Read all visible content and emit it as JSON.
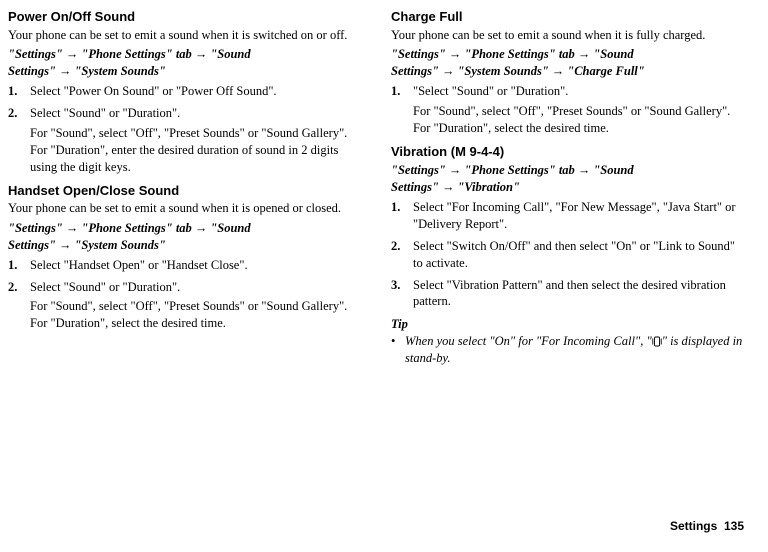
{
  "left": {
    "s1": {
      "title": "Power On/Off Sound",
      "intro": "Your phone can be set to emit a sound when it is switched on or off.",
      "path": [
        "\"Settings\"",
        "\"Phone Settings\" tab",
        "\"Sound Settings\"",
        "\"System Sounds\""
      ],
      "steps": [
        {
          "main": "Select \"Power On Sound\" or \"Power Off Sound\"."
        },
        {
          "main": "Select \"Sound\" or \"Duration\".",
          "sub": "For \"Sound\", select \"Off\", \"Preset Sounds\" or \"Sound Gallery\".\nFor \"Duration\", enter the desired duration of sound in 2 digits using the digit keys."
        }
      ]
    },
    "s2": {
      "title": "Handset Open/Close Sound",
      "intro": "Your phone can be set to emit a sound when it is opened or closed.",
      "path": [
        "\"Settings\"",
        "\"Phone Settings\" tab",
        "\"Sound Settings\"",
        "\"System Sounds\""
      ],
      "steps": [
        {
          "main": "Select \"Handset Open\" or \"Handset Close\"."
        },
        {
          "main": "Select \"Sound\" or \"Duration\".",
          "sub": "For \"Sound\", select \"Off\", \"Preset Sounds\" or \"Sound Gallery\".\nFor \"Duration\", select the desired time."
        }
      ]
    }
  },
  "right": {
    "s1": {
      "title": "Charge Full",
      "intro": "Your phone can be set to emit a sound when it is fully charged.",
      "path": [
        "\"Settings\"",
        "\"Phone Settings\" tab",
        "\"Sound Settings\"",
        "\"System Sounds\"",
        "\"Charge Full\""
      ],
      "steps": [
        {
          "main": "\"Select \"Sound\" or \"Duration\".",
          "sub": "For \"Sound\", select \"Off\", \"Preset Sounds\" or \"Sound Gallery\".\nFor \"Duration\", select the desired time."
        }
      ]
    },
    "s2": {
      "title": "Vibration",
      "mcode": "(M 9-4-4)",
      "path": [
        "\"Settings\"",
        "\"Phone Settings\" tab",
        "\"Sound Settings\"",
        "\"Vibration\""
      ],
      "steps": [
        {
          "main": "Select \"For Incoming Call\", \"For New Message\", \"Java Start\" or \"Delivery Report\"."
        },
        {
          "main": "Select \"Switch On/Off\" and then select \"On\" or \"Link to Sound\" to activate."
        },
        {
          "main": "Select \"Vibration Pattern\" and then select the desired vibration pattern."
        }
      ],
      "tip_head": "Tip",
      "tip_pre": "When you select \"On\" for \"For Incoming Call\", \"",
      "tip_post": "\" is displayed in stand-by."
    }
  },
  "footer": {
    "label": "Settings",
    "page": "135"
  }
}
